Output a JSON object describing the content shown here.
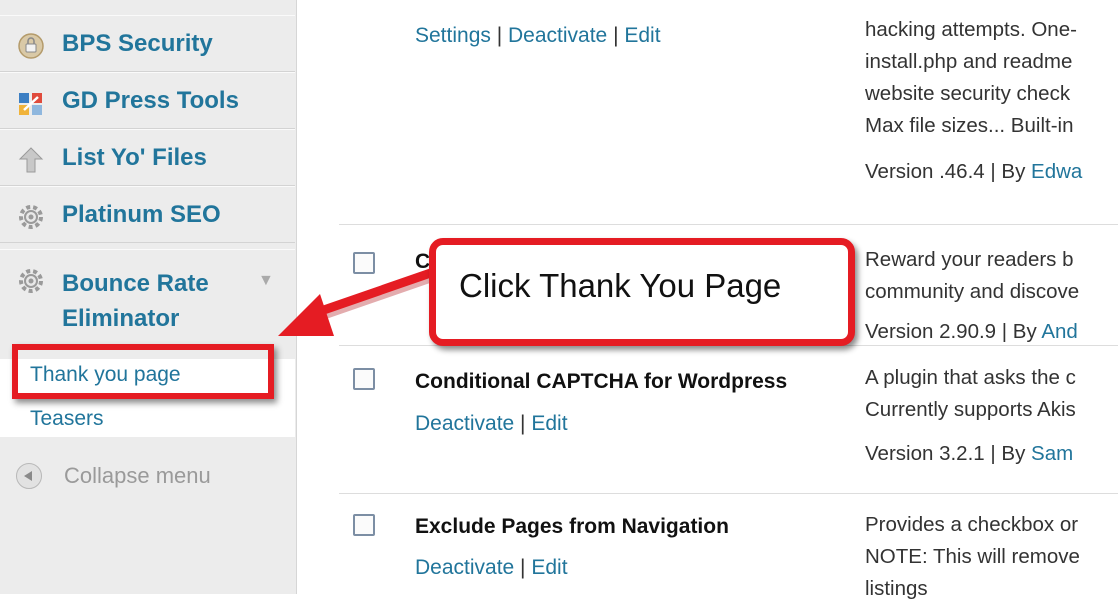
{
  "sidebar": {
    "items": [
      {
        "label": "BPS Security",
        "icon": "shield-lock-icon"
      },
      {
        "label": "GD Press Tools",
        "icon": "tools-icon"
      },
      {
        "label": "List Yo' Files",
        "icon": "upload-arrow-icon"
      },
      {
        "label": "Platinum SEO",
        "icon": "gear-icon"
      }
    ],
    "bounce": {
      "line1": "Bounce Rate",
      "line2": "Eliminator",
      "icon": "gear-icon"
    },
    "submenu": [
      "Thank you page",
      "Teasers"
    ],
    "collapse_label": "Collapse menu"
  },
  "plugins": {
    "row0": {
      "actions": [
        "Settings",
        "Deactivate",
        "Edit"
      ],
      "desc": [
        "hacking attempts. One-",
        "install.php and readme",
        "website security check",
        "Max file sizes... Built-in"
      ],
      "version": "Version .46.4",
      "by": "By",
      "author": "Edwa"
    },
    "row1": {
      "name": "C",
      "desc": [
        "Reward your readers b",
        "community and discove"
      ],
      "version": "Version 2.90.9",
      "by": "By",
      "author": "And"
    },
    "row2": {
      "name": "Conditional CAPTCHA for Wordpress",
      "actions": [
        "Deactivate",
        "Edit"
      ],
      "desc": [
        "A plugin that asks the c",
        "Currently supports Akis"
      ],
      "version": "Version 3.2.1",
      "by": "By",
      "author": "Sam"
    },
    "row3": {
      "name": "Exclude Pages from Navigation",
      "actions": [
        "Deactivate",
        "Edit"
      ],
      "desc": [
        "Provides a checkbox or",
        "NOTE: This will remove",
        "listings"
      ]
    }
  },
  "callout": {
    "text": "Click Thank You Page"
  },
  "colors": {
    "accent": "#e51c23",
    "link": "#21759b"
  }
}
